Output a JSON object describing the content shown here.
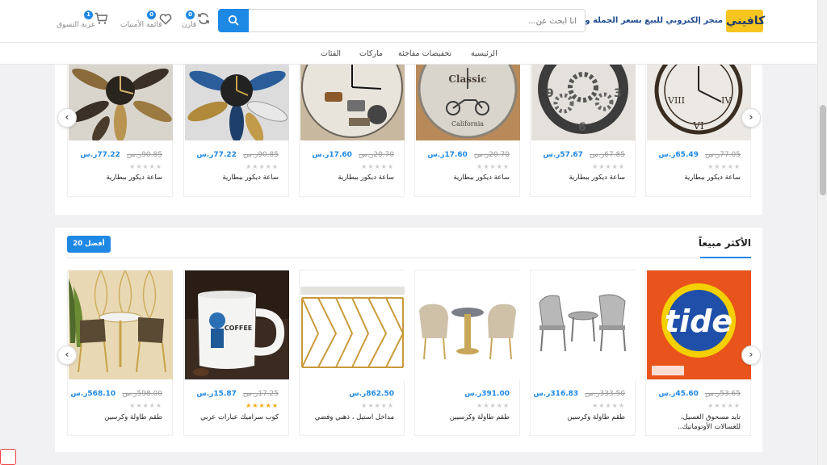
{
  "header": {
    "logo_badge": "كافيني",
    "logo_subtitle": "متجر إلكتروني للبيع بسعر الجملة و التجزئة",
    "search_placeholder": "أنا أبحث عن...",
    "compare": {
      "label": "قارن",
      "count": "0"
    },
    "wishlist": {
      "label": "قائمة الأمنيات",
      "count": "0"
    },
    "cart": {
      "label": "عربة التسوق",
      "count": "1"
    },
    "accent_color": "#1e88e5"
  },
  "nav": {
    "items": [
      "الرئيسية",
      "تخفيضات مفاجئة",
      "ماركات",
      "الفئات"
    ]
  },
  "section_clocks": {
    "products": [
      {
        "name": "ساعة ديكور ببطارية",
        "old_price": "77.05ر.س",
        "new_price": "65.49ر.س",
        "rating": "★★★★★",
        "icon": "roman-metal-clock"
      },
      {
        "name": "ساعة ديكور ببطارية",
        "old_price": "67.85ر.س",
        "new_price": "57.67ر.س",
        "rating": "★★★★★",
        "icon": "gear-clock"
      },
      {
        "name": "ساعة ديكور ببطارية",
        "old_price": "20.70ر.س",
        "new_price": "17.60ر.س",
        "rating": "★★★★★",
        "icon": "vintage-motorcycle-clock"
      },
      {
        "name": "ساعة ديكور ببطارية",
        "old_price": "20.70ر.س",
        "new_price": "17.60ر.س",
        "rating": "★★★★★",
        "icon": "bistro-clock"
      },
      {
        "name": "ساعة ديكور ببطارية",
        "old_price": "90.85ر.س",
        "new_price": "77.22ر.س",
        "rating": "★★★★★",
        "icon": "blue-leaf-clock"
      },
      {
        "name": "ساعة ديكور ببطارية",
        "old_price": "90.85ر.س",
        "new_price": "77.22ر.س",
        "rating": "★★★★★",
        "icon": "gold-leaf-clock"
      }
    ]
  },
  "section_bestsellers": {
    "title": "الأكثر مبيعاً",
    "button": "أفضل 20",
    "products": [
      {
        "name": "تايد مسحوق الغسيل، للغسالات الأوتوماتيك..",
        "old_price": "53.65ر.س",
        "new_price": "45.60ر.س",
        "rating": "★★★★★",
        "rated": false,
        "icon": "detergent-box"
      },
      {
        "name": "طقم طاولة وكرسين",
        "old_price": "333.50ر.س",
        "new_price": "316.83ر.س",
        "rating": "★★★★★",
        "rated": false,
        "icon": "rattan-chairs"
      },
      {
        "name": "طقم طاولة وكرسيين",
        "old_price": "",
        "new_price": "391.00ر.س",
        "rating": "★★★★★",
        "rated": false,
        "icon": "beige-chairs"
      },
      {
        "name": "مداخل استيل ، ذهبي وفضي",
        "old_price": "",
        "new_price": "862.50ر.س",
        "rating": "★★★★★",
        "rated": false,
        "icon": "gold-console-table"
      },
      {
        "name": "كوب سراميك عبارات عربي",
        "old_price": "17.25ر.س",
        "new_price": "15.87ر.س",
        "rating": "★★★★★",
        "rated": true,
        "icon": "ceramic-mug"
      },
      {
        "name": "طقم طاولة وكرسين",
        "old_price": "598.00ر.س",
        "new_price": "568.10ر.س",
        "rating": "★★★★★",
        "rated": false,
        "icon": "velvet-chairs"
      }
    ]
  }
}
